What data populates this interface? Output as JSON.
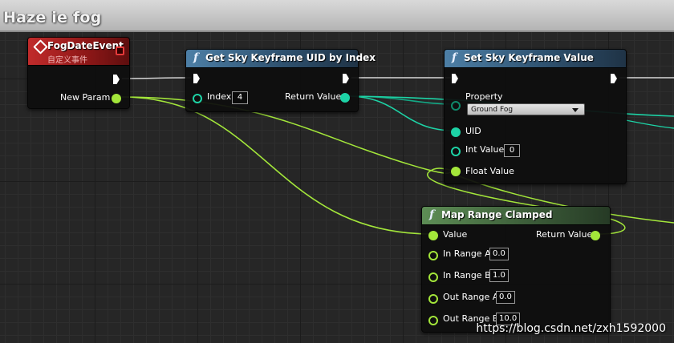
{
  "comment": {
    "title": "Haze ie fog"
  },
  "event_node": {
    "title": "FogDateEvent",
    "subtitle": "自定义事件",
    "pins": {
      "new_param": "New Param"
    }
  },
  "get_uid_node": {
    "title": "Get Sky Keyframe UID by Index",
    "pins": {
      "index": "Index",
      "index_value": "4",
      "return_value": "Return Value"
    }
  },
  "set_value_node": {
    "title": "Set Sky Keyframe Value",
    "pins": {
      "property": "Property",
      "property_value": "Ground Fog",
      "uid": "UID",
      "int_value": "Int Value",
      "int_value_value": "0",
      "float_value": "Float Value"
    }
  },
  "map_range_node": {
    "title": "Map Range Clamped",
    "pins": {
      "value": "Value",
      "return_value": "Return Value",
      "in_range_a": "In Range A",
      "in_range_a_value": "0.0",
      "in_range_b": "In Range B",
      "in_range_b_value": "1.0",
      "out_range_a": "Out Range A",
      "out_range_a_value": "0.0",
      "out_range_b": "Out Range B",
      "out_range_b_value": "10.0"
    }
  },
  "watermark": "https://blog.csdn.net/zxh1592000",
  "colors": {
    "exec_wire": "#ffffff",
    "float_pin": "#a3e63a",
    "struct_pin": "#1dd3a6",
    "function_header": "#4d7fa6",
    "pure_header": "#5d8d55",
    "event_header": "#c12b2b"
  }
}
